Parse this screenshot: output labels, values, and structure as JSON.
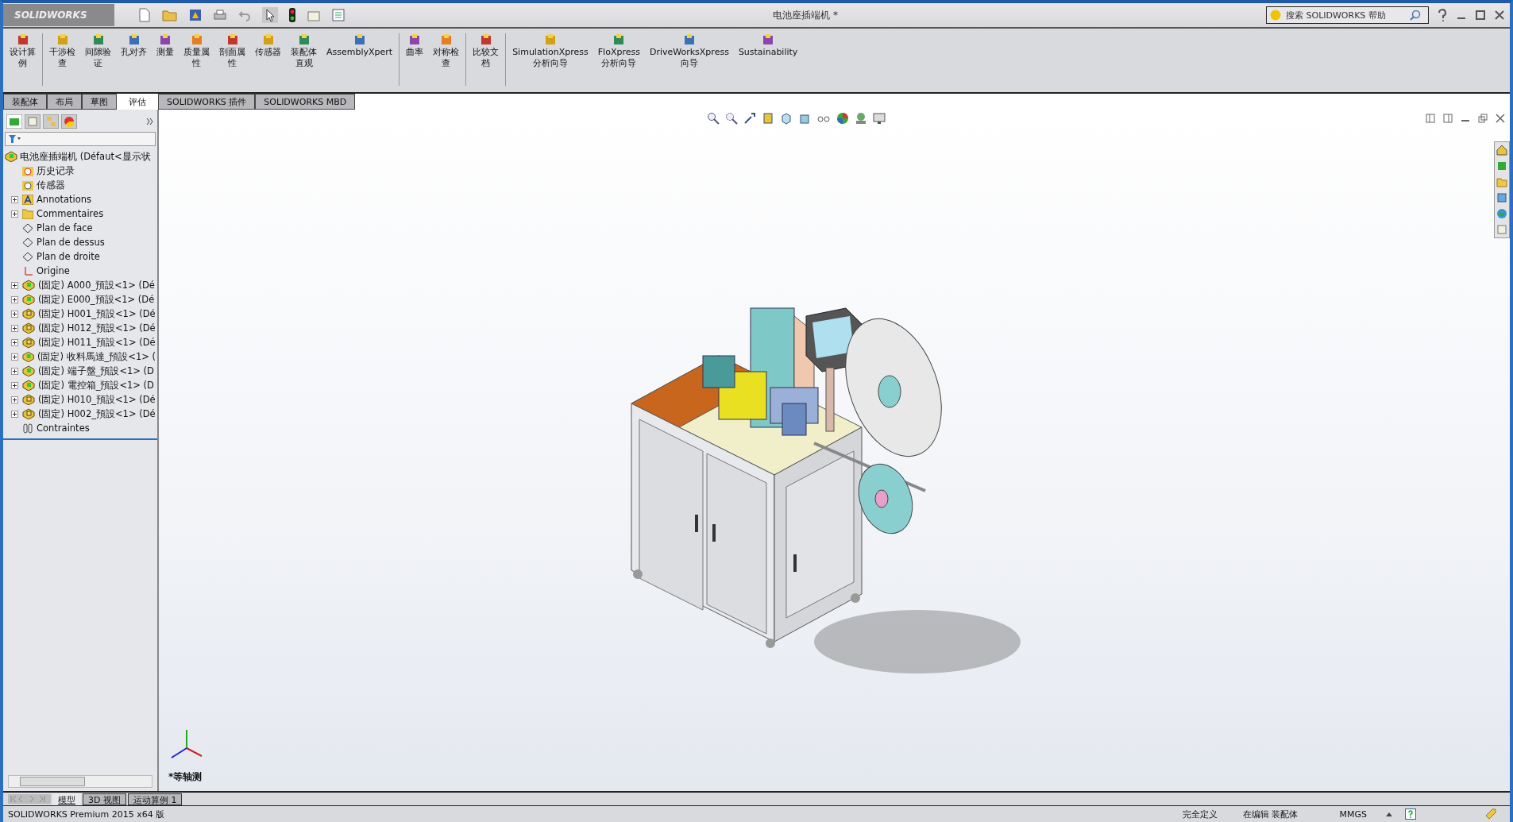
{
  "app": {
    "logo": "SOLIDWORKS",
    "title": "电池座插端机 *"
  },
  "search": {
    "placeholder": "搜索 SOLIDWORKS 帮助"
  },
  "ribbon": [
    {
      "lines": [
        "设计算",
        "例"
      ]
    },
    {
      "lines": [
        "干涉检",
        "查"
      ]
    },
    {
      "lines": [
        "间隙验",
        "证"
      ]
    },
    {
      "lines": [
        "孔对齐"
      ]
    },
    {
      "lines": [
        "测量"
      ]
    },
    {
      "lines": [
        "质量属",
        "性"
      ]
    },
    {
      "lines": [
        "剖面属",
        "性"
      ]
    },
    {
      "lines": [
        "传感器"
      ]
    },
    {
      "lines": [
        "装配体",
        "直观"
      ]
    },
    {
      "lines": [
        "AssemblyXpert"
      ]
    },
    {
      "lines": [
        "曲率"
      ]
    },
    {
      "lines": [
        "对称检",
        "查"
      ]
    },
    {
      "lines": [
        "比较文",
        "档"
      ]
    },
    {
      "lines": [
        "SimulationXpress",
        "分析向导"
      ]
    },
    {
      "lines": [
        "FloXpress",
        "分析向导"
      ]
    },
    {
      "lines": [
        "DriveWorksXpress",
        "向导"
      ]
    },
    {
      "lines": [
        "Sustainability"
      ]
    }
  ],
  "tabs": [
    {
      "label": "装配体",
      "selected": false
    },
    {
      "label": "布局",
      "selected": false
    },
    {
      "label": "草图",
      "selected": false
    },
    {
      "label": "评估",
      "selected": true
    },
    {
      "label": "SOLIDWORKS 插件",
      "selected": false
    },
    {
      "label": "SOLIDWORKS MBD",
      "selected": false
    }
  ],
  "tree": {
    "label": "电池座插端机  (Défaut<显示状",
    "kind": "assembly",
    "children": [
      {
        "label": "历史记录",
        "kind": "history",
        "collapsed": false
      },
      {
        "label": "传感器",
        "kind": "sensor",
        "collapsed": false
      },
      {
        "label": "Annotations",
        "kind": "annotation",
        "collapsed": true
      },
      {
        "label": "Commentaires",
        "kind": "folder",
        "collapsed": true
      },
      {
        "label": "Plan de face",
        "kind": "plane",
        "collapsed": false
      },
      {
        "label": "Plan de dessus",
        "kind": "plane",
        "collapsed": false
      },
      {
        "label": "Plan de droite",
        "kind": "plane",
        "collapsed": false
      },
      {
        "label": "Origine",
        "kind": "origin",
        "collapsed": false
      },
      {
        "label": "(固定) A000_預設<1> (Dé",
        "kind": "sub_green",
        "collapsed": true
      },
      {
        "label": "(固定) E000_預設<1> (Dé",
        "kind": "sub_green",
        "collapsed": true
      },
      {
        "label": "(固定) H001_預設<1> (Dé",
        "kind": "sub_yellow",
        "collapsed": true
      },
      {
        "label": "(固定) H012_預設<1> (Dé",
        "kind": "sub_yellow",
        "collapsed": true
      },
      {
        "label": "(固定) H011_預設<1> (Dé",
        "kind": "sub_yellow",
        "collapsed": true
      },
      {
        "label": "(固定) 收料馬達_預設<1> (",
        "kind": "sub_green",
        "collapsed": true
      },
      {
        "label": "(固定) 端子盤_預設<1> (D",
        "kind": "sub_green",
        "collapsed": true
      },
      {
        "label": "(固定) 電控箱_預設<1> (D",
        "kind": "sub_green",
        "collapsed": true
      },
      {
        "label": "(固定) H010_預設<1> (Dé",
        "kind": "sub_yellow",
        "collapsed": true
      },
      {
        "label": "(固定) H002_預設<1> (Dé",
        "kind": "sub_yellow",
        "collapsed": true
      },
      {
        "label": "Contraintes",
        "kind": "mates",
        "collapsed": false
      }
    ]
  },
  "viewport": {
    "view_name": "*等轴测"
  },
  "bottom_tabs": [
    {
      "label": "模型",
      "selected": true
    },
    {
      "label": "3D 视图",
      "selected": false
    },
    {
      "label": "运动算例 1",
      "selected": false
    }
  ],
  "status_bar": {
    "product": "SOLIDWORKS Premium 2015 x64 版",
    "state": "完全定义",
    "mode": "在编辑 装配体",
    "units": "MMGS"
  }
}
